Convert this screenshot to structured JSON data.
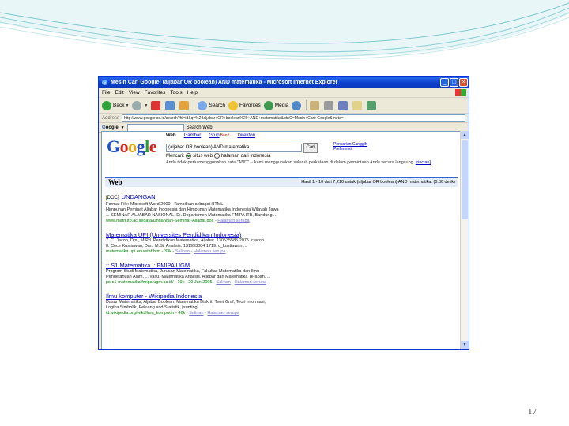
{
  "slide": {
    "page_number": "17"
  },
  "browser": {
    "title": "Mesin Cari Google: (aljabar OR boolean) AND matematika - Microsoft Internet Explorer",
    "window_buttons": {
      "minimize": "_",
      "maximize": "□",
      "close": "×"
    },
    "menu": [
      "File",
      "Edit",
      "View",
      "Favorites",
      "Tools",
      "Help"
    ],
    "toolbar": {
      "back": "Back",
      "search": "Search",
      "favorites": "Favorites",
      "media": "Media"
    },
    "address_label": "Address",
    "address_value": "http://www.google.co.id/search?hl=id&q=%28aljabar+OR+boolean%29+AND+matematika&btnG=Mesin+Cari+Google&meta=",
    "googlebar_search": "Search Web"
  },
  "google": {
    "logo": [
      "G",
      "o",
      "o",
      "g",
      "l",
      "e"
    ],
    "tabs": {
      "web": "Web",
      "images": "Gambar",
      "groups": "Grup",
      "new_badge": "Baru!",
      "directory": "Direktori"
    },
    "query": "(aljabar OR boolean) AND matematika",
    "search_button": "Cari",
    "advanced_search": "Pencarian Canggih",
    "preferences": "Preferensi",
    "scope_label": "Mencari:",
    "scope_web": "situs web",
    "scope_id": "halaman dari Indonesia",
    "hint_text": "Anda tidak perlu menggunakan kata \"AND\" -- kami menggunakan seluruh perkataan di dalam permintaan Anda secara langsung.",
    "hint_link": "[rincian]",
    "results_label": "Web",
    "results_stats": "Hasil 1 - 10 dari 7,210 untuk (aljabar OR boolean) AND matematika. (0.30 detik)"
  },
  "results": [
    {
      "tag": "[DOC]",
      "title": "UNDANGAN",
      "lines": [
        "Format File: Microsoft Word 2000 - Tampilkan sebagai HTML",
        "Himpunan Peminat Aljabar Indonesia dan Himpunan Matematika Indonesia Wilayah Jawa",
        "... SEMINAR ALJABAR NASIONAL. Di. Departemen Matematika FMIPA ITB, Bandung ..."
      ],
      "url": "www.math.itb.ac.id/data/Undangan-Seminar-Aljabar.doc",
      "links": [
        "Halaman serupa"
      ]
    },
    {
      "tag": "",
      "title": "Matematika UPI (Universites Pendidikan Indonesia)",
      "lines": [
        "7. C. Jacob, Drs., M.Pd. Pendidikan Matematika, Aljabar. 130535585 2075. cjacob",
        "8. Cece Kustiawan, Drs., M.Si. Analisis. 131993084 1719. c_kustiawan ..."
      ],
      "url": "matematika.upi.edu/staf.htm - 33k -",
      "links": [
        "Salinan",
        "Halaman serupa"
      ]
    },
    {
      "tag": "",
      "title": ":: S1 Matematika :: FMIPA UGM",
      "lines": [
        "Program Studi Matematika, Jurusan Matematika, Fakultas Matematika dan Ilmu",
        "Pengetahuan Alam. ... yaitu: Matematika Analisis, Aljabar dan Matematika Terapan. ..."
      ],
      "url": "ps-s1-matematika.fmipa.ugm.ac.id/ - 19k - 20 Jun 2005 -",
      "links": [
        "Salinan",
        "Halaman serupa"
      ]
    },
    {
      "tag": "",
      "title": "Ilmu komputer - Wikipedia Indonesia",
      "lines": [
        "Dasar Matematika, Aljabar Boolean, Matematika Diskrit, Teori Graf, Teori Informasi,",
        "Logika Simbolik, Peluang and Statistik, [sunting] ..."
      ],
      "url": "id.wikipedia.org/wiki/Ilmu_komputer - 46k -",
      "links": [
        "Salinan",
        "Halaman serupa"
      ]
    }
  ]
}
